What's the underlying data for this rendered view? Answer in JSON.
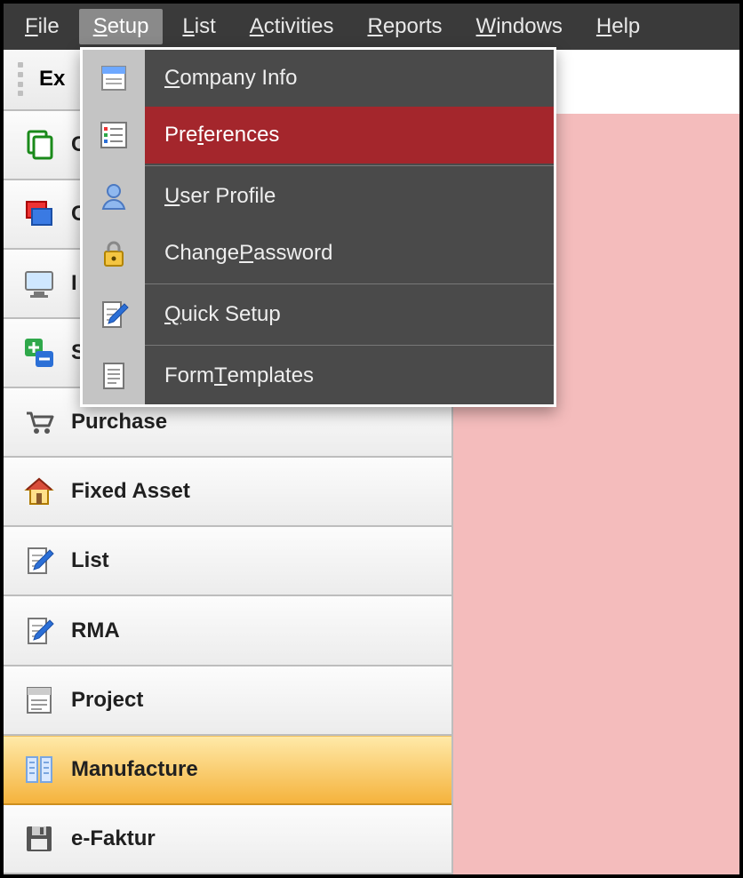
{
  "menubar": {
    "items": [
      {
        "pre": "",
        "u": "F",
        "post": "ile"
      },
      {
        "pre": "",
        "u": "S",
        "post": "etup"
      },
      {
        "pre": "",
        "u": "L",
        "post": "ist"
      },
      {
        "pre": "",
        "u": "A",
        "post": "ctivities"
      },
      {
        "pre": "",
        "u": "R",
        "post": "eports"
      },
      {
        "pre": "",
        "u": "W",
        "post": "indows"
      },
      {
        "pre": "",
        "u": "H",
        "post": "elp"
      }
    ],
    "open_index": 1
  },
  "dropdown": {
    "items": [
      {
        "pre": "",
        "u": "C",
        "post": "ompany Info"
      },
      {
        "pre": "Pre",
        "u": "f",
        "post": "erences"
      },
      {
        "pre": "",
        "u": "U",
        "post": "ser Profile"
      },
      {
        "pre": "Change ",
        "u": "P",
        "post": "assword"
      },
      {
        "pre": "",
        "u": "Q",
        "post": "uick Setup"
      },
      {
        "pre": "Form ",
        "u": "T",
        "post": "emplates"
      }
    ],
    "highlight_index": 1
  },
  "sidebar": {
    "header_label": "Ex",
    "items": [
      {
        "label": "C",
        "icon": "copy-icon"
      },
      {
        "label": "C",
        "icon": "windows-icon"
      },
      {
        "label": "I",
        "icon": "monitor-icon"
      },
      {
        "label": "S",
        "icon": "plus-minus-icon"
      },
      {
        "label": "Purchase",
        "icon": "cart-icon"
      },
      {
        "label": "Fixed Asset",
        "icon": "house-icon"
      },
      {
        "label": "List",
        "icon": "doc-pen-icon"
      },
      {
        "label": "RMA",
        "icon": "doc-pen-icon"
      },
      {
        "label": "Project",
        "icon": "form-icon"
      },
      {
        "label": "Manufacture",
        "icon": "columns-icon"
      },
      {
        "label": "e-Faktur",
        "icon": "floppy-icon"
      }
    ],
    "selected_index": 9
  },
  "icons": {
    "form-icon": "form",
    "list-icon": "list",
    "user-icon": "user",
    "lock-icon": "lock",
    "doc-pen-icon": "docpen",
    "doc-lines-icon": "doclines",
    "copy-icon": "copy",
    "windows-icon": "windows",
    "monitor-icon": "monitor",
    "plus-minus-icon": "plusminus",
    "cart-icon": "cart",
    "house-icon": "house",
    "columns-icon": "columns",
    "floppy-icon": "floppy"
  },
  "colors": {
    "menubar_bg": "#3a3a3a",
    "dropdown_bg": "#4a4a4a",
    "dropdown_highlight": "#a4262c",
    "client_bg": "#f4bcbc",
    "selected_item_top": "#ffe9a8",
    "selected_item_bottom": "#f5b33d"
  }
}
